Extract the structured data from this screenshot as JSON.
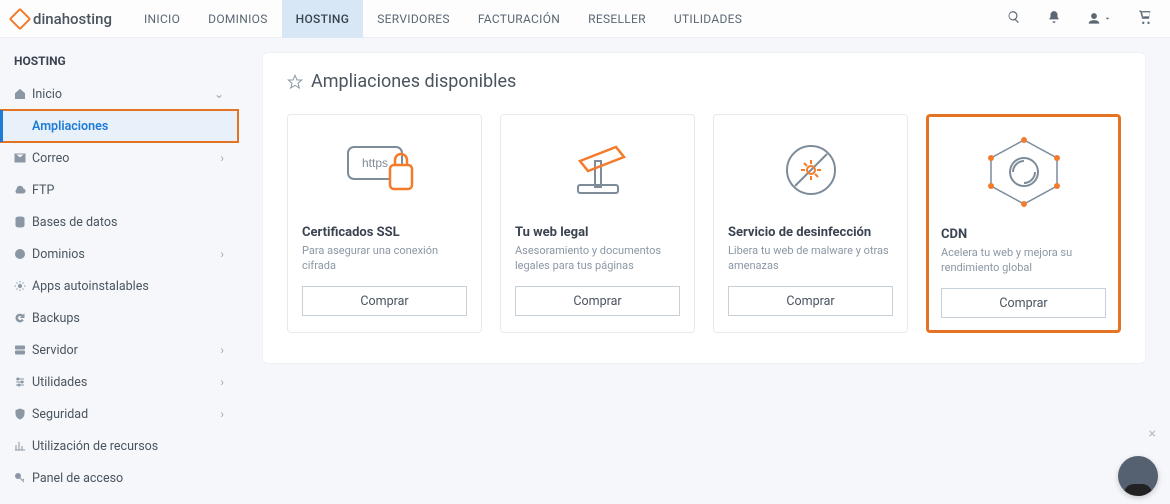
{
  "brand": "dinahosting",
  "nav": [
    {
      "label": "INICIO"
    },
    {
      "label": "DOMINIOS"
    },
    {
      "label": "HOSTING",
      "active": true
    },
    {
      "label": "SERVIDORES"
    },
    {
      "label": "FACTURACIÓN"
    },
    {
      "label": "RESELLER"
    },
    {
      "label": "UTILIDADES"
    }
  ],
  "sidebar": {
    "title": "HOSTING",
    "items": [
      {
        "icon": "home",
        "label": "Inicio",
        "chev": "down"
      },
      {
        "icon": "",
        "label": "Ampliaciones",
        "selected": true,
        "boxed": true
      },
      {
        "icon": "mail",
        "label": "Correo",
        "chev": "right"
      },
      {
        "icon": "cloud",
        "label": "FTP"
      },
      {
        "icon": "db",
        "label": "Bases de datos"
      },
      {
        "icon": "globe",
        "label": "Dominios",
        "chev": "right"
      },
      {
        "icon": "gear",
        "label": "Apps autoinstalables"
      },
      {
        "icon": "refresh",
        "label": "Backups"
      },
      {
        "icon": "server",
        "label": "Servidor",
        "chev": "right"
      },
      {
        "icon": "sliders",
        "label": "Utilidades",
        "chev": "right"
      },
      {
        "icon": "shield",
        "label": "Seguridad",
        "chev": "right"
      },
      {
        "icon": "chart",
        "label": "Utilización de recursos"
      },
      {
        "icon": "key",
        "label": "Panel de acceso"
      }
    ]
  },
  "panel": {
    "title": "Ampliaciones disponibles",
    "cards": [
      {
        "title": "Certificados SSL",
        "desc": "Para asegurar una conexión cifrada",
        "button": "Comprar"
      },
      {
        "title": "Tu web legal",
        "desc": "Asesoramiento y documentos legales para tus páginas",
        "button": "Comprar"
      },
      {
        "title": "Servicio de desinfección",
        "desc": "Libera tu web de malware y otras amenazas",
        "button": "Comprar"
      },
      {
        "title": "CDN",
        "desc": "Acelera tu web y mejora su rendimiento global",
        "button": "Comprar",
        "highlighted": true
      }
    ]
  }
}
